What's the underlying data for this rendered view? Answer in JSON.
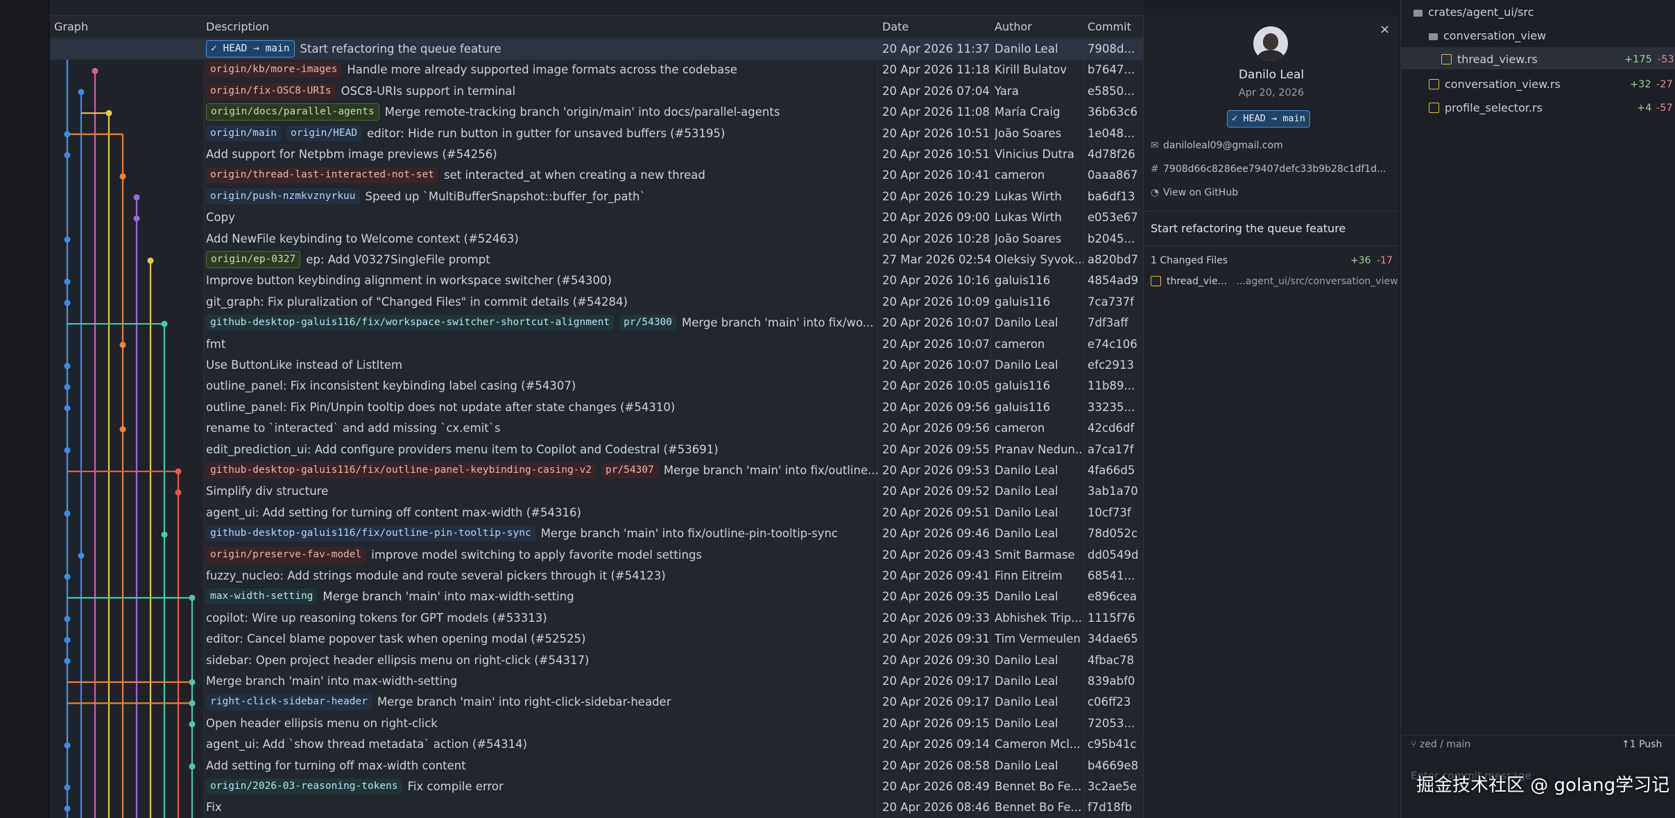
{
  "columns": {
    "graph": "Graph",
    "description": "Description",
    "date": "Date",
    "author": "Author",
    "commit": "Commit"
  },
  "colors": {
    "accent_blue": "#3a8ee6",
    "orange": "#e8843c",
    "pink": "#d65c9a",
    "yellow": "#e6c84a",
    "purple": "#9a6ad6",
    "teal": "#4ac9a6",
    "red": "#e35a4a",
    "gold": "#e0b84a",
    "added": "#9ed29a",
    "removed": "#e38f8f"
  },
  "rows": [
    {
      "tags": [
        {
          "t": "✓ HEAD → main",
          "c": "head"
        }
      ],
      "desc": "Start refactoring the queue feature",
      "date": "20 Apr 2026 11:37",
      "author": "Danilo Leal",
      "commit": "7908d...",
      "selected": true
    },
    {
      "tags": [
        {
          "t": "origin/kb/more-images",
          "c": "red"
        }
      ],
      "desc": "Handle more already supported image formats across the codebase",
      "date": "20 Apr 2026 11:18",
      "author": "Kirill Bulatov",
      "commit": "b7647..."
    },
    {
      "tags": [
        {
          "t": "origin/fix-OSC8-URIs",
          "c": "red"
        }
      ],
      "desc": "OSC8-URIs support in terminal",
      "date": "20 Apr 2026 07:04",
      "author": "Yara",
      "commit": "e5850..."
    },
    {
      "tags": [
        {
          "t": "origin/docs/parallel-agents",
          "c": "green"
        }
      ],
      "desc": "Merge remote-tracking branch 'origin/main' into docs/parallel-agents",
      "date": "20 Apr 2026 11:08",
      "author": "María Craig",
      "commit": "36b63c6"
    },
    {
      "tags": [
        {
          "t": "origin/main",
          "c": "blue"
        },
        {
          "t": "origin/HEAD",
          "c": "blue"
        }
      ],
      "desc": "editor: Hide run button in gutter for unsaved buffers (#53195)",
      "date": "20 Apr 2026 10:51",
      "author": "João Soares",
      "commit": "1e048..."
    },
    {
      "tags": [],
      "desc": "Add support for Netpbm image previews (#54256)",
      "date": "20 Apr 2026 10:51",
      "author": "Vinicius Dutra",
      "commit": "4d78f26"
    },
    {
      "tags": [
        {
          "t": "origin/thread-last-interacted-not-set",
          "c": "red"
        }
      ],
      "desc": "set interacted_at when creating a new thread",
      "date": "20 Apr 2026 10:41",
      "author": "cameron",
      "commit": "0aaa867"
    },
    {
      "tags": [
        {
          "t": "origin/push-nzmkvznyrkuu",
          "c": "blue"
        }
      ],
      "desc": "Speed up `MultiBufferSnapshot::buffer_for_path`",
      "date": "20 Apr 2026 10:29",
      "author": "Lukas Wirth",
      "commit": "ba6df13"
    },
    {
      "tags": [],
      "desc": "Copy",
      "date": "20 Apr 2026 09:00",
      "author": "Lukas Wirth",
      "commit": "e053e67"
    },
    {
      "tags": [],
      "desc": "Add NewFile keybinding to Welcome context (#52463)",
      "date": "20 Apr 2026 10:28",
      "author": "João Soares",
      "commit": "b2045..."
    },
    {
      "tags": [
        {
          "t": "origin/ep-0327",
          "c": "green"
        }
      ],
      "desc": "ep: Add V0327SingleFile prompt",
      "date": "27 Mar 2026 02:54",
      "author": "Oleksiy Syvok...",
      "commit": "a820bd7"
    },
    {
      "tags": [],
      "desc": "Improve button keybinding alignment in workspace switcher (#54300)",
      "date": "20 Apr 2026 10:16",
      "author": "galuis116",
      "commit": "4854ad9"
    },
    {
      "tags": [],
      "desc": "git_graph: Fix pluralization of \"Changed Files\" in commit details (#54284)",
      "date": "20 Apr 2026 10:09",
      "author": "galuis116",
      "commit": "7ca737f"
    },
    {
      "tags": [
        {
          "t": "github-desktop-galuis116/fix/workspace-switcher-shortcut-alignment",
          "c": "teal"
        },
        {
          "t": "pr/54300",
          "c": "teal"
        }
      ],
      "desc": "Merge branch 'main' into fix/wo...",
      "date": "20 Apr 2026 10:07",
      "author": "Danilo Leal",
      "commit": "7df3aff"
    },
    {
      "tags": [],
      "desc": "fmt",
      "date": "20 Apr 2026 10:07",
      "author": "cameron",
      "commit": "e74c106"
    },
    {
      "tags": [],
      "desc": "Use ButtonLike instead of ListItem",
      "date": "20 Apr 2026 10:07",
      "author": "Danilo Leal",
      "commit": "efc2913"
    },
    {
      "tags": [],
      "desc": "outline_panel: Fix inconsistent keybinding label casing (#54307)",
      "date": "20 Apr 2026 10:05",
      "author": "galuis116",
      "commit": "11b89..."
    },
    {
      "tags": [],
      "desc": "outline_panel: Fix Pin/Unpin tooltip does not update after state changes (#54310)",
      "date": "20 Apr 2026 09:56",
      "author": "galuis116",
      "commit": "33235..."
    },
    {
      "tags": [],
      "desc": "rename to `interacted` and add missing `cx.emit`s",
      "date": "20 Apr 2026 09:56",
      "author": "cameron",
      "commit": "42cd6df"
    },
    {
      "tags": [],
      "desc": "edit_prediction_ui: Add configure providers menu item to Copilot and Codestral (#53691)",
      "date": "20 Apr 2026 09:55",
      "author": "Pranav Nedun...",
      "commit": "a7ca17f"
    },
    {
      "tags": [
        {
          "t": "github-desktop-galuis116/fix/outline-panel-keybinding-casing-v2",
          "c": "red"
        },
        {
          "t": "pr/54307",
          "c": "red"
        }
      ],
      "desc": "Merge branch 'main' into fix/outline...",
      "date": "20 Apr 2026 09:53",
      "author": "Danilo Leal",
      "commit": "4fa66d5"
    },
    {
      "tags": [],
      "desc": "Simplify div structure",
      "date": "20 Apr 2026 09:52",
      "author": "Danilo Leal",
      "commit": "3ab1a70"
    },
    {
      "tags": [],
      "desc": "agent_ui: Add setting for turning off content max-width (#54316)",
      "date": "20 Apr 2026 09:51",
      "author": "Danilo Leal",
      "commit": "10cf73f"
    },
    {
      "tags": [
        {
          "t": "github-desktop-galuis116/fix/outline-pin-tooltip-sync",
          "c": "blue"
        }
      ],
      "desc": "Merge branch 'main' into fix/outline-pin-tooltip-sync",
      "date": "20 Apr 2026 09:46",
      "author": "Danilo Leal",
      "commit": "78d052c"
    },
    {
      "tags": [
        {
          "t": "origin/preserve-fav-model",
          "c": "red"
        }
      ],
      "desc": "improve model switching to apply favorite model settings",
      "date": "20 Apr 2026 09:43",
      "author": "Smit Barmase",
      "commit": "dd0549d"
    },
    {
      "tags": [],
      "desc": "fuzzy_nucleo: Add strings module and route several pickers through it (#54123)",
      "date": "20 Apr 2026 09:41",
      "author": "Finn Eitreim",
      "commit": "68541..."
    },
    {
      "tags": [
        {
          "t": "max-width-setting",
          "c": "teal"
        }
      ],
      "desc": "Merge branch 'main' into max-width-setting",
      "date": "20 Apr 2026 09:35",
      "author": "Danilo Leal",
      "commit": "e896cea"
    },
    {
      "tags": [],
      "desc": "copilot: Wire up reasoning tokens for GPT models (#53313)",
      "date": "20 Apr 2026 09:33",
      "author": "Abhishek Trip...",
      "commit": "1115f76"
    },
    {
      "tags": [],
      "desc": "editor: Cancel blame popover task when opening modal (#52525)",
      "date": "20 Apr 2026 09:31",
      "author": "Tim Vermeulen",
      "commit": "34dae65"
    },
    {
      "tags": [],
      "desc": "sidebar: Open project header ellipsis menu on right-click (#54317)",
      "date": "20 Apr 2026 09:30",
      "author": "Danilo Leal",
      "commit": "4fbac78"
    },
    {
      "tags": [],
      "desc": "Merge branch 'main' into max-width-setting",
      "date": "20 Apr 2026 09:17",
      "author": "Danilo Leal",
      "commit": "839abf0"
    },
    {
      "tags": [
        {
          "t": "right-click-sidebar-header",
          "c": "blue"
        }
      ],
      "desc": "Merge branch 'main' into right-click-sidebar-header",
      "date": "20 Apr 2026 09:17",
      "author": "Danilo Leal",
      "commit": "c06ff23"
    },
    {
      "tags": [],
      "desc": "Open header ellipsis menu on right-click",
      "date": "20 Apr 2026 09:15",
      "author": "Danilo Leal",
      "commit": "72053..."
    },
    {
      "tags": [],
      "desc": "agent_ui: Add `show thread metadata` action (#54314)",
      "date": "20 Apr 2026 09:14",
      "author": "Cameron Mcl...",
      "commit": "c95b41c"
    },
    {
      "tags": [],
      "desc": "Add setting for turning off max-width content",
      "date": "20 Apr 2026 08:58",
      "author": "Danilo Leal",
      "commit": "b4669e8"
    },
    {
      "tags": [
        {
          "t": "origin/2026-03-reasoning-tokens",
          "c": "teal"
        }
      ],
      "desc": "Fix compile error",
      "date": "20 Apr 2026 08:49",
      "author": "Bennet Bo Fe...",
      "commit": "3c2ae5e"
    },
    {
      "tags": [],
      "desc": "Fix",
      "date": "20 Apr 2026 08:46",
      "author": "Bennet Bo Fe...",
      "commit": "f7d18fb"
    }
  ],
  "detail": {
    "close": "×",
    "name": "Danilo Leal",
    "date": "Apr 20, 2026",
    "head_tag": "✓ HEAD → main",
    "email": "daniloleal09@gmail.com",
    "hash": "7908d66c8286ee79407defc33b9b28c1df1d...",
    "github": "View on GitHub",
    "message": "Start refactoring the queue feature",
    "changed": "1 Changed Files",
    "plus": "+36",
    "minus": "-17",
    "file_name": "thread_vie...",
    "file_path": "...agent_ui/src/conversation_view"
  },
  "tree": {
    "root": "crates/agent_ui/src",
    "folder": "conversation_view",
    "files": [
      {
        "name": "thread_view.rs",
        "plus": "+175",
        "minus": "-53"
      },
      {
        "name": "conversation_view.rs",
        "plus": "+32",
        "minus": "-27"
      },
      {
        "name": "profile_selector.rs",
        "plus": "+4",
        "minus": "-57"
      }
    ],
    "branch": "zed / main",
    "push": "↑1 Push",
    "commit_placeholder": "Enter commit message",
    "watermark": "掘金技术社区 @ golang学习记"
  }
}
